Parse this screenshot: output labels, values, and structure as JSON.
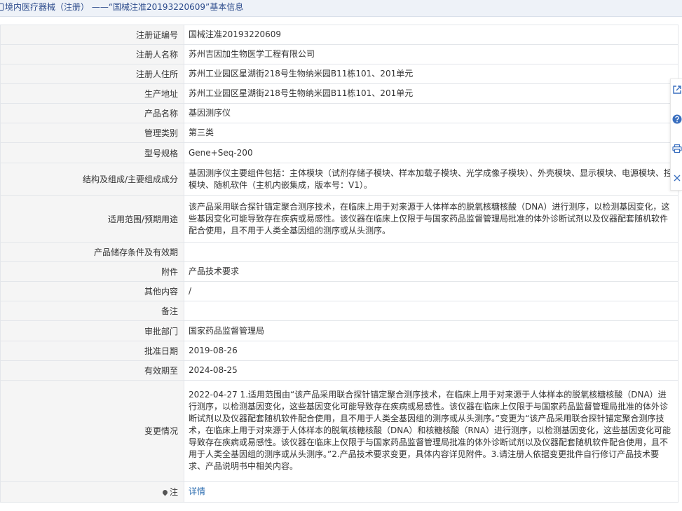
{
  "header": {
    "title": "境内医疗器械（注册）  ——“国械注准20193220609”基本信息"
  },
  "rows": [
    {
      "label": "注册证编号",
      "value": "国械注准20193220609"
    },
    {
      "label": "注册人名称",
      "value": "苏州吉因加生物医学工程有限公司"
    },
    {
      "label": "注册人住所",
      "value": "苏州工业园区星湖街218号生物纳米园B11栋101、201单元"
    },
    {
      "label": "生产地址",
      "value": "苏州工业园区星湖街218号生物纳米园B11栋101、201单元"
    },
    {
      "label": "产品名称",
      "value": "基因测序仪"
    },
    {
      "label": "管理类别",
      "value": "第三类"
    },
    {
      "label": "型号规格",
      "value": "Gene+Seq-200"
    },
    {
      "label": "结构及组成/主要组成成分",
      "value_line1": "基因测序仪主要组件包括：主体模块（试剂存储子模块、样本加载子模块、光学成像子模块）、外壳模块、显示模块、电源模块、控制",
      "value_line2": "模块、随机软件（主机内嵌集成，版本号：V1）。"
    },
    {
      "label": "适用范围/预期用途",
      "value": "该产品采用联合探针锚定聚合测序技术，在临床上用于对来源于人体样本的脱氧核糖核酸（DNA）进行测序，以检测基因变化，这些基因变化可能导致存在疾病或易感性。该仪器在临床上仅限于与国家药品监督管理局批准的体外诊断试剂以及仪器配套随机软件配合使用，且不用于人类全基因组的测序或从头测序。"
    },
    {
      "label": "产品储存条件及有效期",
      "value": ""
    },
    {
      "label": "附件",
      "value": "产品技术要求"
    },
    {
      "label": "其他内容",
      "value": "/"
    },
    {
      "label": "备注",
      "value": ""
    },
    {
      "label": "审批部门",
      "value": "国家药品监督管理局"
    },
    {
      "label": "批准日期",
      "value": "2019-08-26"
    },
    {
      "label": "有效期至",
      "value": "2024-08-25"
    },
    {
      "label": "变更情况",
      "value": "2022-04-27 1.适用范围由“该产品采用联合探针锚定聚合测序技术，在临床上用于对来源于人体样本的脱氧核糖核酸（DNA）进行测序，以检测基因变化，这些基因变化可能导致存在疾病或易感性。该仪器在临床上仅限于与国家药品监督管理局批准的体外诊断试剂以及仪器配套随机软件配合使用，且不用于人类全基因组的测序或从头测序。”变更为“该产品采用联合探针锚定聚合测序技术，在临床上用于对来源于人体样本的脱氧核糖核酸（DNA）和核糖核酸（RNA）进行测序，以检测基因变化，这些基因变化可能导致存在疾病或易感性。该仪器在临床上仅限于与国家药品监督管理局批准的体外诊断试剂以及仪器配套随机软件配合使用，且不用于人类全基因组的测序或从头测序。”2.产品技术要求变更，具体内容详见附件。3.请注册人依据变更批件自行修订产品技术要求、产品说明书中相关内容。"
    },
    {
      "label": "注",
      "value": "详情"
    }
  ],
  "side_toolbar": {
    "icons": [
      "share-icon",
      "help-icon",
      "print-icon",
      "close-icon"
    ]
  },
  "colors": {
    "header_bg": "#eef2f8",
    "header_text": "#2b4a8b",
    "label_bg": "#f5f5f5",
    "border": "#e3e6ea",
    "link": "#2b6cb0",
    "icon": "#3a6fbf"
  }
}
